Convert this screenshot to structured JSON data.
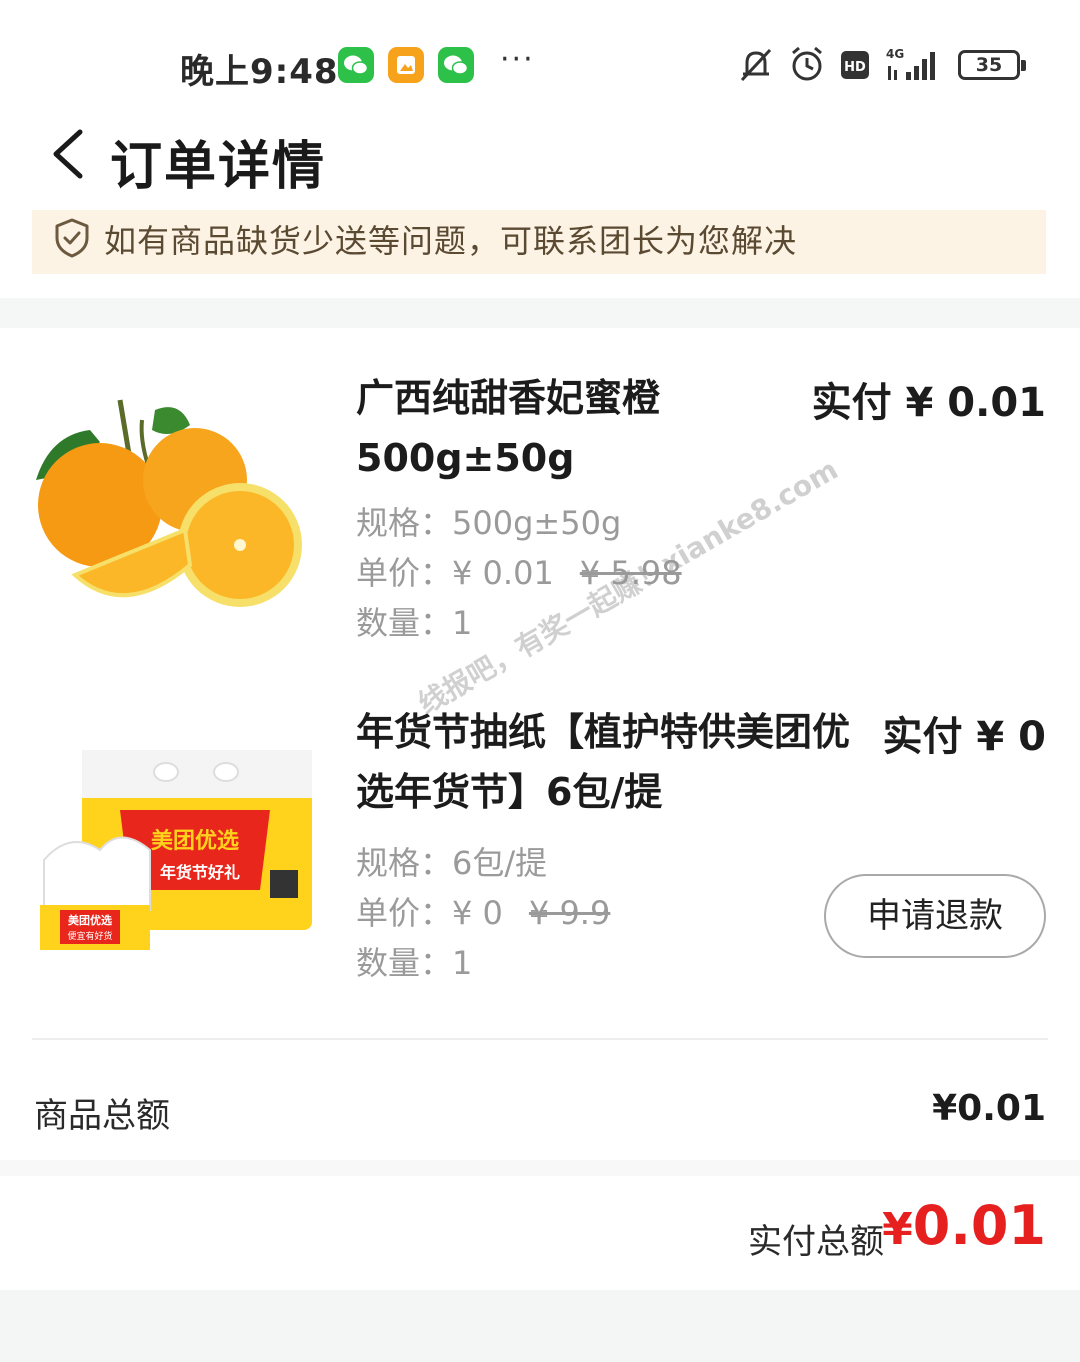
{
  "status_bar": {
    "time": "晚上9:48",
    "more": "···",
    "battery": "35",
    "icons": [
      "wechat-icon",
      "gallery-icon",
      "wechat-icon",
      "mute-icon",
      "alarm-icon",
      "hd-icon",
      "signal-4g-icon",
      "battery-icon"
    ]
  },
  "header": {
    "title": "订单详情",
    "back_icon": "chevron-left-icon"
  },
  "notice": {
    "icon": "shield-check-icon",
    "text": "如有商品缺货少送等问题，可联系团长为您解决"
  },
  "items": [
    {
      "name": "广西纯甜香妃蜜橙500g±50g",
      "paid": "实付 ¥ 0.01",
      "spec_label": "规格：",
      "spec": "500g±50g",
      "price_label": "单价：",
      "price": "¥ 0.01",
      "original_price": "¥ 5.98",
      "qty_label": "数量：",
      "qty": "1"
    },
    {
      "name": "年货节抽纸【植护特供美团优选年货节】6包/提",
      "paid": "实付 ¥ 0",
      "spec_label": "规格：",
      "spec": "6包/提",
      "price_label": "单价：",
      "price": "¥ 0",
      "original_price": "¥ 9.9",
      "qty_label": "数量：",
      "qty": "1",
      "package_text_main": "美团优选",
      "package_text_sub": "年货节好礼",
      "package_small": "美团优选",
      "package_small_sub": "便宜有好货",
      "action": "申请退款"
    }
  ],
  "summary": {
    "goods_total_label": "商品总额",
    "goods_total": "¥0.01",
    "paid_total_label": "实付总额",
    "paid_total_symbol": "¥",
    "paid_total_value": "0.01"
  },
  "watermark": "线报吧，有奖一起赚！xianke8.com",
  "colors": {
    "accent_red": "#e6201f",
    "notice_bg": "#fdf3e5",
    "wechat_green": "#2dc14a"
  }
}
